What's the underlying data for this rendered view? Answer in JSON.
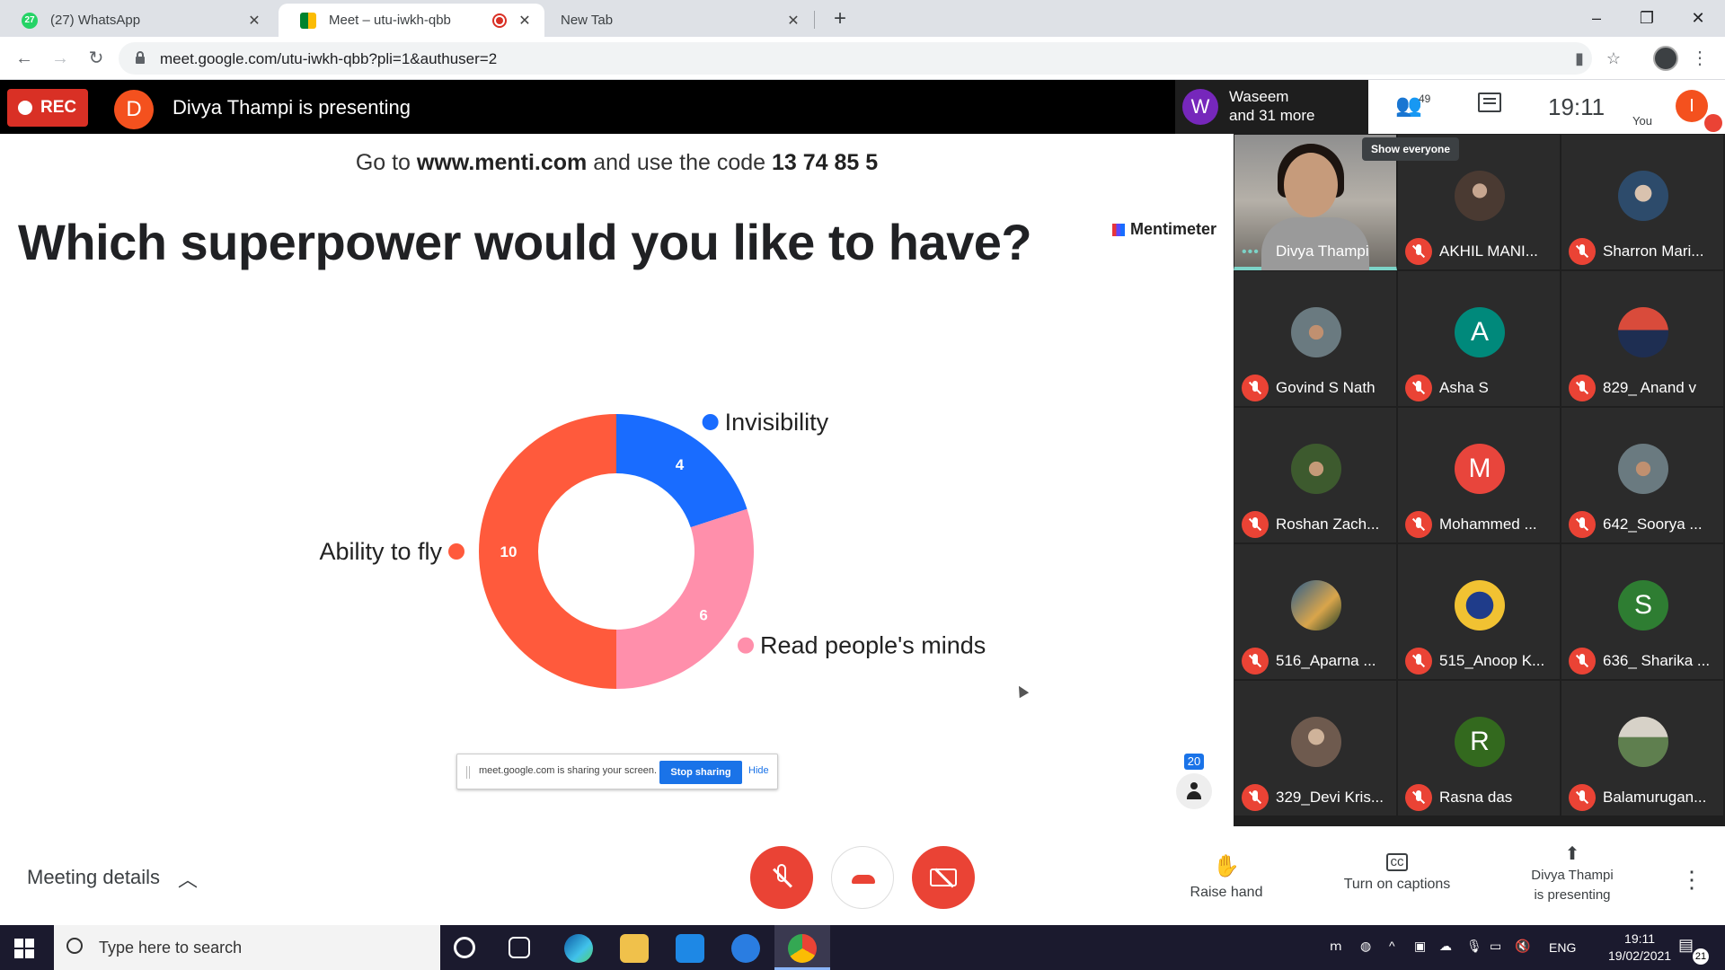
{
  "browser": {
    "tabs": [
      {
        "label": "(27) WhatsApp",
        "favicon": "whatsapp-icon"
      },
      {
        "label": "Meet – utu-iwkh-qbb",
        "favicon": "google-meet-icon",
        "recording": true
      },
      {
        "label": "New Tab"
      }
    ],
    "url": "meet.google.com/utu-iwkh-qbb?pli=1&authuser=2"
  },
  "meet_header": {
    "rec_label": "REC",
    "presenter_initial": "D",
    "presenting_text": "Divya Thampi is presenting",
    "waseem_initial": "W",
    "waseem_line1": "Waseem",
    "waseem_line2": "and 31 more",
    "people_count": "49",
    "clock": "19:11",
    "you_label": "You",
    "you_initial": "I"
  },
  "slide": {
    "header_prefix": "Go to ",
    "header_site": "www.menti.com",
    "header_mid": " and use the code ",
    "header_code": "13 74 85 5",
    "brand": "Mentimeter",
    "question": "Which superpower would you like to have?",
    "participants_count": "20"
  },
  "chart_data": {
    "type": "pie",
    "donut": true,
    "categories": [
      "Invisibility",
      "Read people's minds",
      "Ability to fly"
    ],
    "values": [
      4,
      6,
      10
    ],
    "colors": [
      "#196cff",
      "#ff8fab",
      "#ff5a3c"
    ]
  },
  "share_banner": {
    "text": "meet.google.com is sharing your screen.",
    "stop_label": "Stop sharing",
    "hide_label": "Hide"
  },
  "grid": {
    "show_everyone": "Show everyone",
    "participants": [
      {
        "name": "Divya Thampi",
        "initial": "",
        "style": "self"
      },
      {
        "name": "AKHIL MANI...",
        "initial": "",
        "style": "photo"
      },
      {
        "name": "Sharron Mari...",
        "initial": "",
        "style": "photo2"
      },
      {
        "name": "Govind S Nath",
        "initial": "",
        "style": "photo3"
      },
      {
        "name": "Asha S",
        "initial": "A",
        "color": "#00897b"
      },
      {
        "name": "829_ Anand v",
        "initial": "",
        "style": "photo4"
      },
      {
        "name": "Roshan Zach...",
        "initial": "",
        "style": "photo5"
      },
      {
        "name": "Mohammed ...",
        "initial": "M",
        "color": "#e8453c"
      },
      {
        "name": "642_Soorya ...",
        "initial": "",
        "style": "photo3"
      },
      {
        "name": "516_Aparna ...",
        "initial": "",
        "style": "photo6"
      },
      {
        "name": "515_Anoop K...",
        "initial": "",
        "style": "photo7"
      },
      {
        "name": "636_ Sharika ...",
        "initial": "S",
        "color": "#2e7d32"
      },
      {
        "name": "329_Devi Kris...",
        "initial": "",
        "style": "photo9"
      },
      {
        "name": "Rasna das",
        "initial": "R",
        "color": "#33691e"
      },
      {
        "name": "Balamurugan...",
        "initial": "",
        "style": "photo8"
      }
    ]
  },
  "bottom": {
    "meeting_details": "Meeting details",
    "raise_hand": "Raise hand",
    "captions": "Turn on captions",
    "presenting_line1": "Divya Thampi",
    "presenting_line2": "is presenting"
  },
  "taskbar": {
    "search_placeholder": "Type here to search",
    "lang": "ENG",
    "time": "19:11",
    "date": "19/02/2021",
    "notifications": "21"
  }
}
